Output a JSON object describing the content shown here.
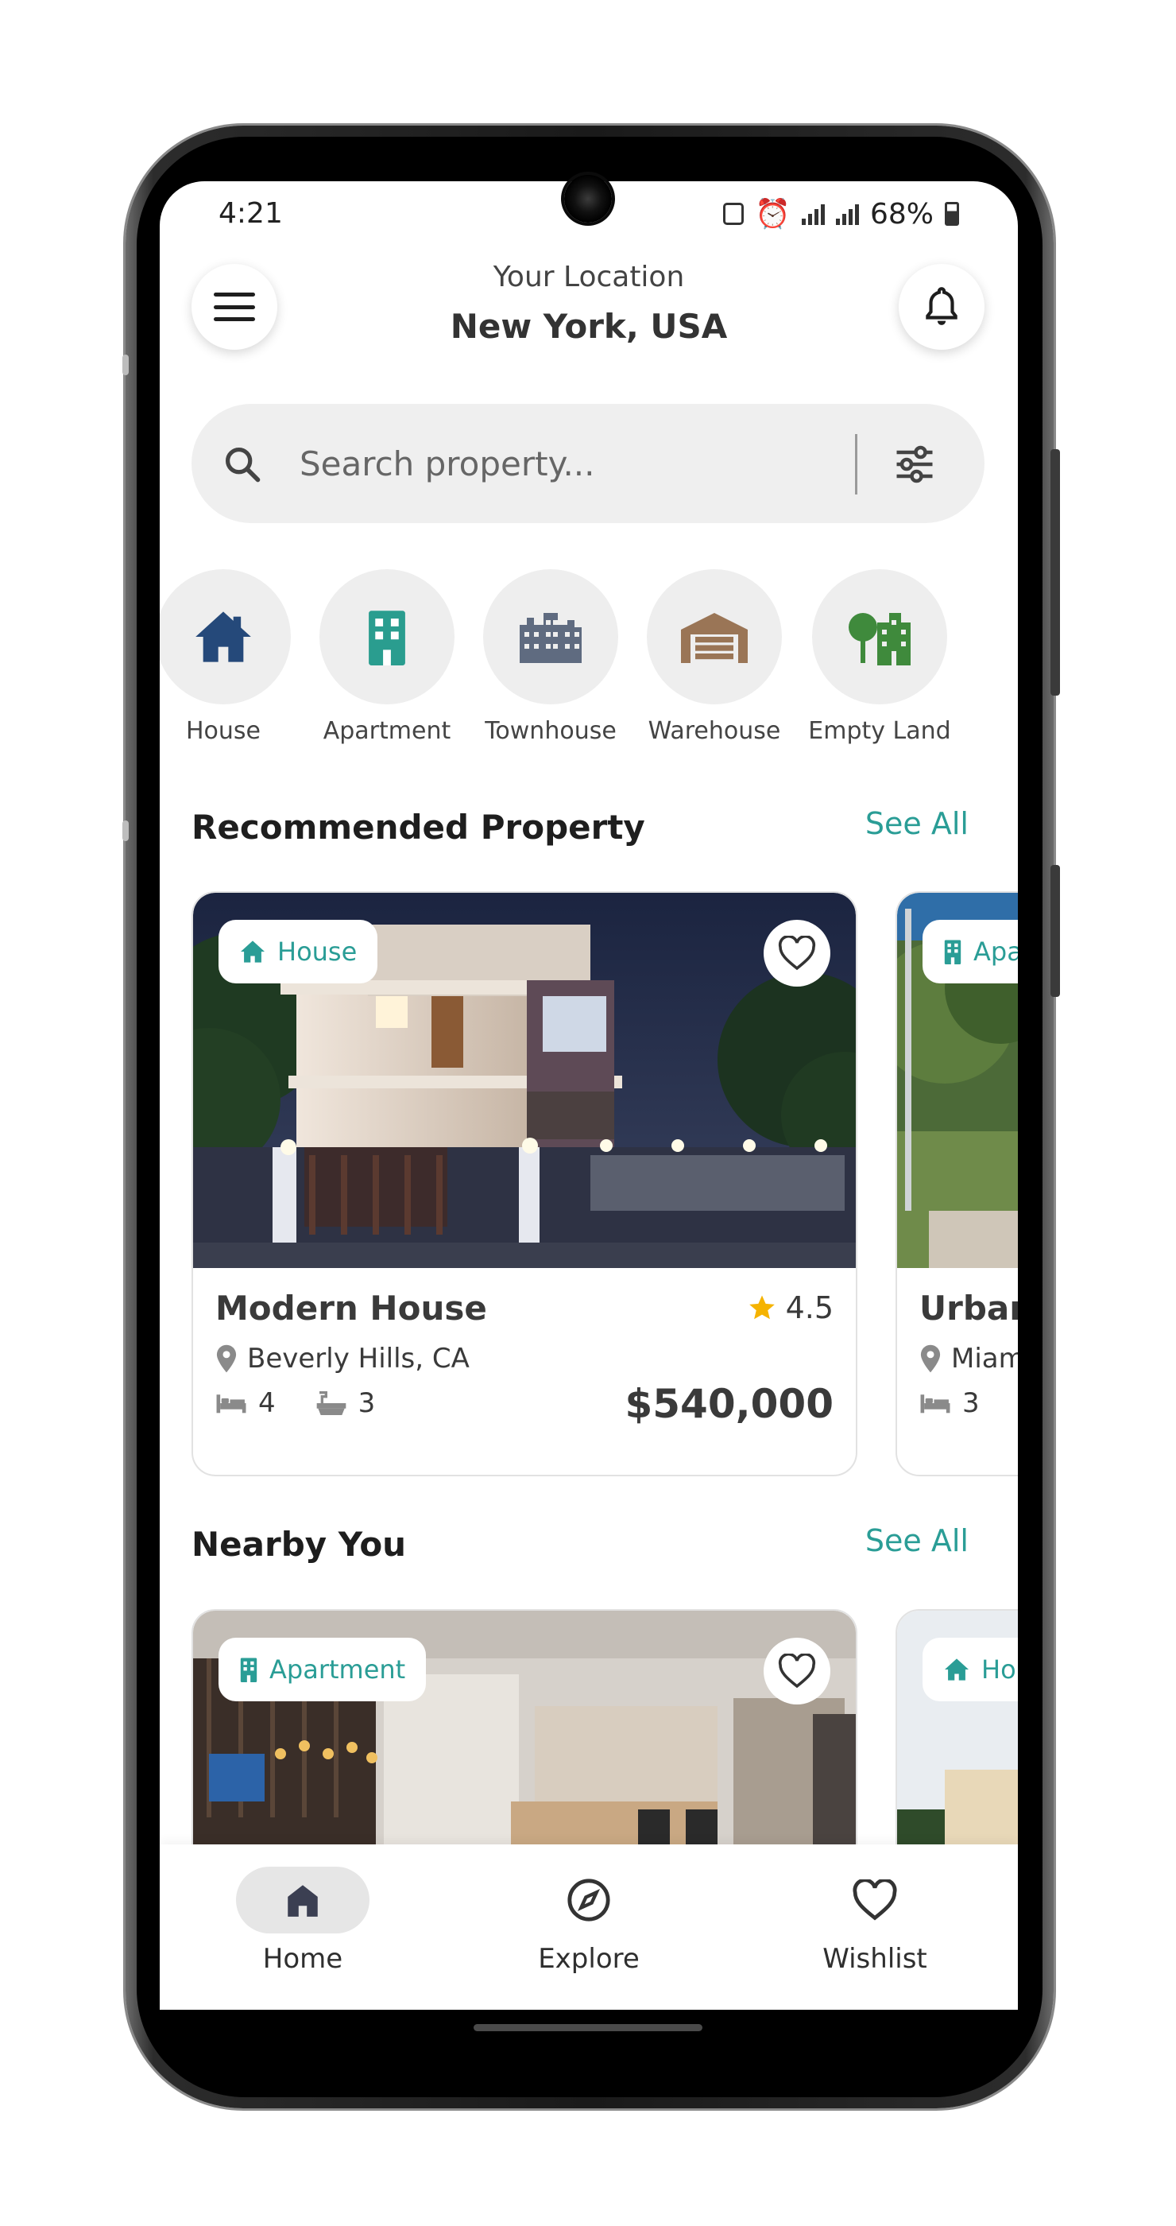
{
  "status_bar": {
    "time": "4:21",
    "battery": "68%"
  },
  "header": {
    "location_label": "Your Location",
    "location_value": "New York, USA"
  },
  "search": {
    "placeholder": "Search property..."
  },
  "categories": [
    {
      "label": "House",
      "icon": "house-icon",
      "color": "#25497a"
    },
    {
      "label": "Apartment",
      "icon": "apartment-icon",
      "color": "#2a9d8f"
    },
    {
      "label": "Townhouse",
      "icon": "townhouse-icon",
      "color": "#5f6b80"
    },
    {
      "label": "Warehouse",
      "icon": "warehouse-icon",
      "color": "#9a7556"
    },
    {
      "label": "Empty Land",
      "icon": "tree-icon",
      "color": "#3f8a3c"
    }
  ],
  "recommended": {
    "title": "Recommended Property",
    "see_all": "See All",
    "cards": [
      {
        "tag": "House",
        "title": "Modern House",
        "rating": "4.5",
        "location": "Beverly Hills, CA",
        "beds": "4",
        "baths": "3",
        "price": "$540,000"
      },
      {
        "tag": "Apa",
        "title": "Urban",
        "location": "Miam",
        "beds": "3"
      }
    ]
  },
  "nearby": {
    "title": "Nearby You",
    "see_all": "See All",
    "cards": [
      {
        "tag": "Apartment"
      },
      {
        "tag": "Hou"
      }
    ]
  },
  "bottom_nav": [
    {
      "label": "Home",
      "icon": "home-icon",
      "active": true
    },
    {
      "label": "Explore",
      "icon": "compass-icon",
      "active": false
    },
    {
      "label": "Wishlist",
      "icon": "heart-icon",
      "active": false
    }
  ],
  "colors": {
    "accent": "#2a9d96",
    "star": "#f5b300",
    "text": "#3a3a3a"
  }
}
